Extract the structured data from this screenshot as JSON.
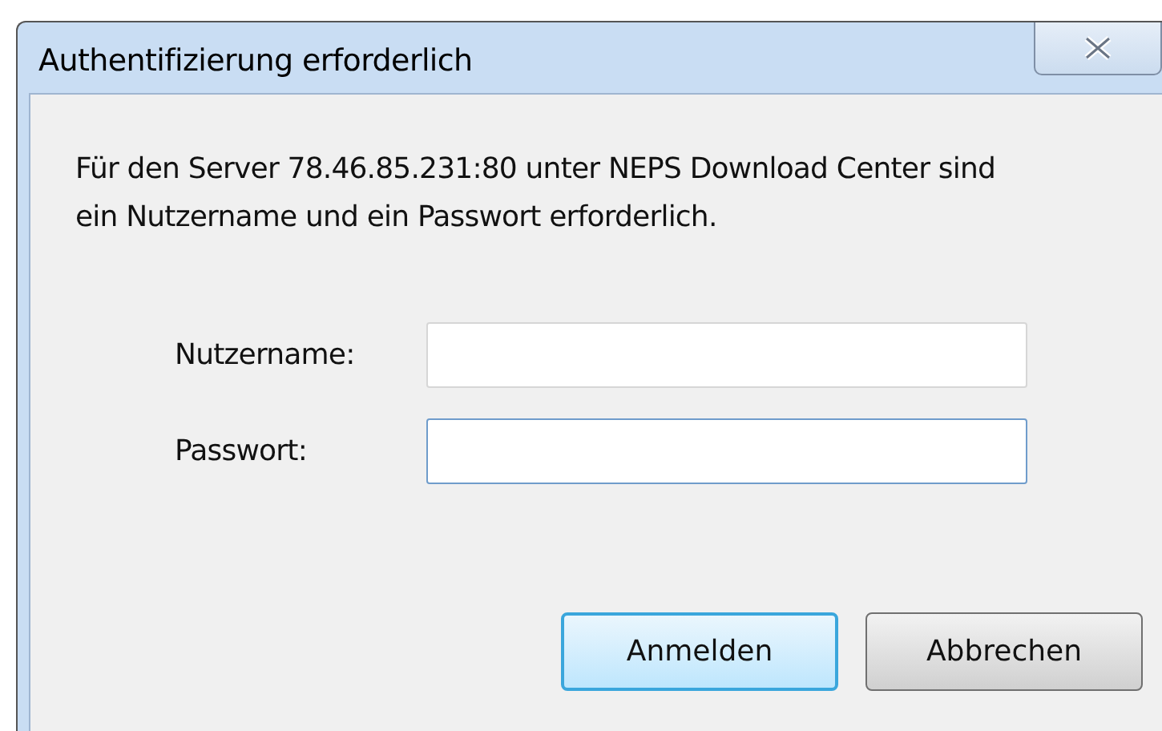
{
  "window": {
    "title": "Authentifizierung erforderlich"
  },
  "message": "Für den Server 78.46.85.231:80 unter NEPS Download Center sind ein Nutzername und ein Passwort erforderlich.",
  "fields": [
    {
      "label": "Nutzername:",
      "focused": false
    },
    {
      "label": "Passwort:",
      "focused": true
    }
  ],
  "buttons": [
    {
      "label": "Anmelden",
      "default": true
    },
    {
      "label": "Abbrechen",
      "default": false
    }
  ]
}
